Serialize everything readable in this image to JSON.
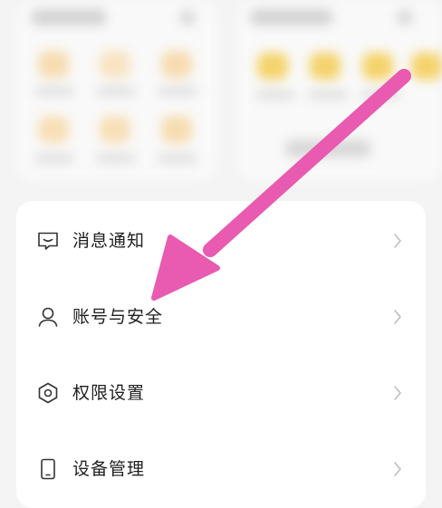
{
  "settings_menu": {
    "items": [
      {
        "label": "消息通知",
        "icon": "message-icon"
      },
      {
        "label": "账号与安全",
        "icon": "user-icon"
      },
      {
        "label": "权限设置",
        "icon": "hexagon-shield-icon"
      },
      {
        "label": "设备管理",
        "icon": "phone-icon"
      }
    ]
  },
  "colors": {
    "accent_arrow": "#e85bb0",
    "tile_yellow": "#f5d36b",
    "tile_orange": "#f6d6a8",
    "text": "#1f1f1f",
    "chevron": "#bdbdbd"
  }
}
